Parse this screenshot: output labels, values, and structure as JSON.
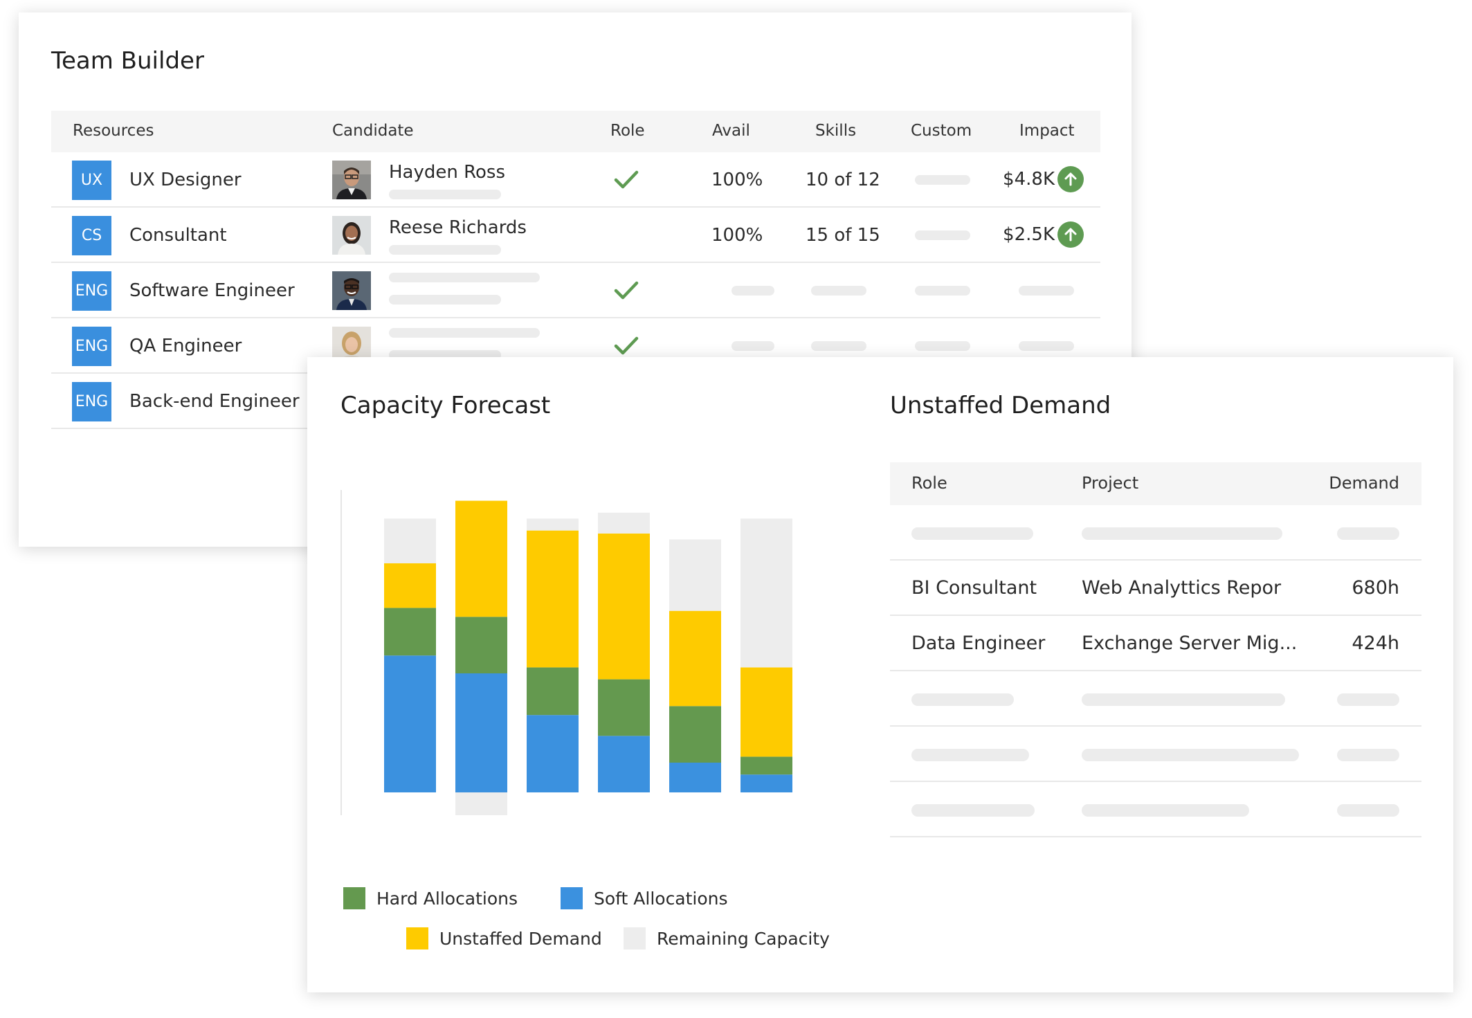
{
  "team_builder": {
    "title": "Team Builder",
    "columns": {
      "resources": "Resources",
      "candidate": "Candidate",
      "role": "Role",
      "avail": "Avail",
      "skills": "Skills",
      "custom": "Custom",
      "impact": "Impact"
    },
    "rows": [
      {
        "badge": "UX",
        "resource": "UX Designer",
        "candidate": "Hayden Ross",
        "role_match": true,
        "avail": "100%",
        "skills": "10 of 12",
        "impact": "$4.8K"
      },
      {
        "badge": "CS",
        "resource": "Consultant",
        "candidate": "Reese Richards",
        "role_match": false,
        "avail": "100%",
        "skills": "15 of 15",
        "impact": "$2.5K"
      },
      {
        "badge": "ENG",
        "resource": "Software Engineer",
        "candidate": "",
        "role_match": true
      },
      {
        "badge": "ENG",
        "resource": "QA Engineer",
        "candidate": "",
        "role_match": true
      },
      {
        "badge": "ENG",
        "resource": "Back-end Engineer",
        "candidate": ""
      }
    ]
  },
  "capacity_forecast": {
    "title": "Capacity Forecast",
    "legend": [
      {
        "label": "Hard Allocations",
        "color": "#64994f"
      },
      {
        "label": "Soft Allocations",
        "color": "#3b91df"
      },
      {
        "label": "Unstaffed Demand",
        "color": "#fecb00"
      },
      {
        "label": "Remaining Capacity",
        "color": "#ededed"
      }
    ]
  },
  "chart_data": {
    "type": "bar",
    "stacked": true,
    "categories": [
      "",
      "",
      "",
      "",
      "",
      ""
    ],
    "series": [
      {
        "name": "Soft Allocations",
        "color": "#3b91df",
        "values": [
          46,
          40,
          26,
          19,
          10,
          6
        ]
      },
      {
        "name": "Hard Allocations",
        "color": "#64994f",
        "values": [
          16,
          19,
          16,
          19,
          19,
          6
        ]
      },
      {
        "name": "Unstaffed Demand",
        "color": "#fecb00",
        "values": [
          15,
          39,
          46,
          49,
          32,
          30
        ]
      },
      {
        "name": "Remaining Capacity",
        "color": "#ededed",
        "values": [
          15,
          0,
          4,
          7,
          24,
          50
        ]
      }
    ],
    "overflow": [
      0,
      9,
      0,
      0,
      0,
      0
    ],
    "grid": false,
    "legend_position": "bottom"
  },
  "unstaffed_demand": {
    "title": "Unstaffed Demand",
    "columns": {
      "role": "Role",
      "project": "Project",
      "demand": "Demand"
    },
    "rows": [
      {
        "role": "",
        "project": "",
        "demand": ""
      },
      {
        "role": "BI Consultant",
        "project": "Web Analyttics Repor",
        "demand": "680h"
      },
      {
        "role": "Data Engineer",
        "project": "Exchange Server Mig...",
        "demand": "424h"
      },
      {
        "role": "",
        "project": "",
        "demand": ""
      },
      {
        "role": "",
        "project": "",
        "demand": ""
      },
      {
        "role": "",
        "project": "",
        "demand": ""
      }
    ]
  },
  "icons": {
    "check": "check-icon",
    "impact_up": "arrow-up-circle-icon",
    "avatars": [
      "avatar-hayden-ross",
      "avatar-reese-richards",
      "avatar-software-engineer",
      "avatar-qa-engineer"
    ]
  },
  "colors": {
    "badge": "#3a8fde",
    "check": "#5e9b52",
    "placeholder": "#ececec"
  }
}
